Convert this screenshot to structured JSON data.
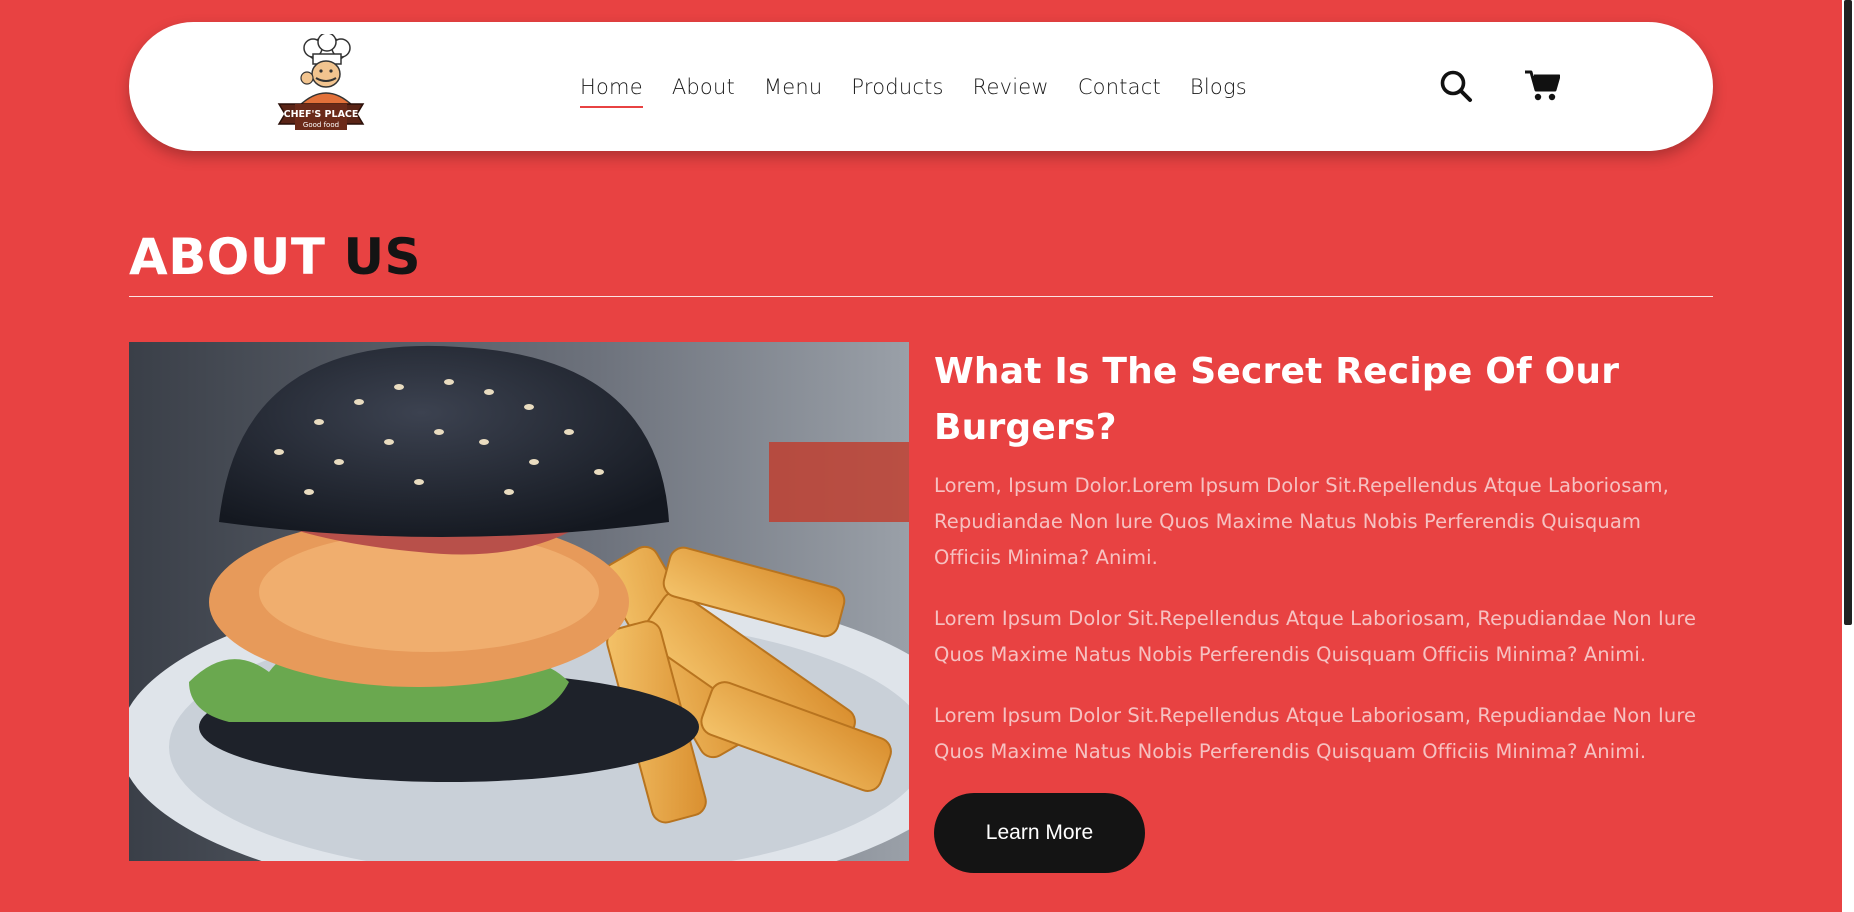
{
  "brand": {
    "logo_name": "CHEF'S PLACE",
    "logo_tagline": "Good food"
  },
  "nav": {
    "items": [
      {
        "label": "Home",
        "active": true
      },
      {
        "label": "About"
      },
      {
        "label": "Menu"
      },
      {
        "label": "Products"
      },
      {
        "label": "Review"
      },
      {
        "label": "Contact"
      },
      {
        "label": "Blogs"
      }
    ]
  },
  "header_icons": {
    "search": "search-icon",
    "cart": "cart-icon"
  },
  "about": {
    "title_part1": "ABOUT",
    "title_part2": "US",
    "heading": "What Is The Secret Recipe Of Our Burgers?",
    "paragraphs": [
      "Lorem, Ipsum Dolor.Lorem Ipsum Dolor Sit.Repellendus Atque Laboriosam, Repudiandae Non Iure Quos Maxime Natus Nobis Perferendis Quisquam Officiis Minima? Animi.",
      "Lorem Ipsum Dolor Sit.Repellendus Atque Laboriosam, Repudiandae Non Iure Quos Maxime Natus Nobis Perferendis Quisquam Officiis Minima? Animi.",
      "Lorem Ipsum Dolor Sit.Repellendus Atque Laboriosam, Repudiandae Non Iure Quos Maxime Natus Nobis Perferendis Quisquam Officiis Minima? Animi."
    ],
    "button_label": "Learn More"
  },
  "colors": {
    "page_background": "#e84242",
    "header_background": "#ffffff",
    "button_background": "#141414",
    "paragraph_text": "#f6c1c1"
  }
}
